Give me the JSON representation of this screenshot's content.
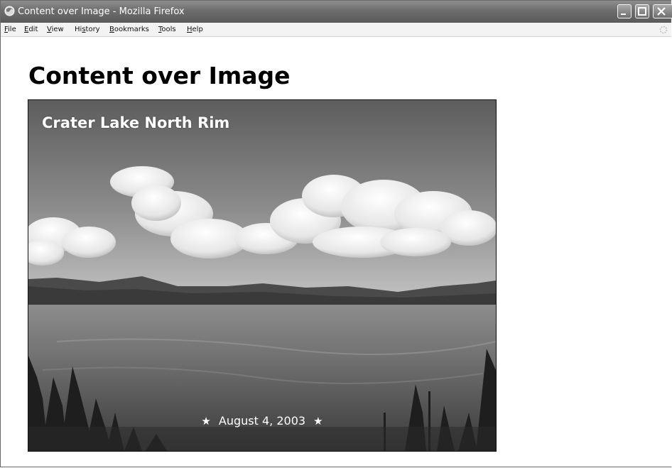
{
  "window": {
    "title": "Content over Image - Mozilla Firefox",
    "icon": "firefox-icon",
    "controls": [
      "minimize-icon",
      "maximize-icon",
      "close-icon"
    ]
  },
  "menu": {
    "items": [
      {
        "key": "F",
        "rest": "ile"
      },
      {
        "key": "E",
        "rest": "dit"
      },
      {
        "key": "V",
        "rest": "iew"
      },
      {
        "key": "",
        "lead": "Hi",
        "ukey": "s",
        "tail": "tory"
      },
      {
        "key": "B",
        "rest": "ookmarks"
      },
      {
        "key": "T",
        "rest": "ools"
      },
      {
        "key": "H",
        "rest": "elp"
      }
    ]
  },
  "page": {
    "heading": "Content over Image",
    "photo": {
      "title": "Crater Lake North Rim",
      "date": "August 4, 2003",
      "star": "★"
    }
  },
  "colors": {
    "titlebar": "#6d6d6d",
    "menubar": "#f3f3f3",
    "photo_border": "#111111"
  }
}
